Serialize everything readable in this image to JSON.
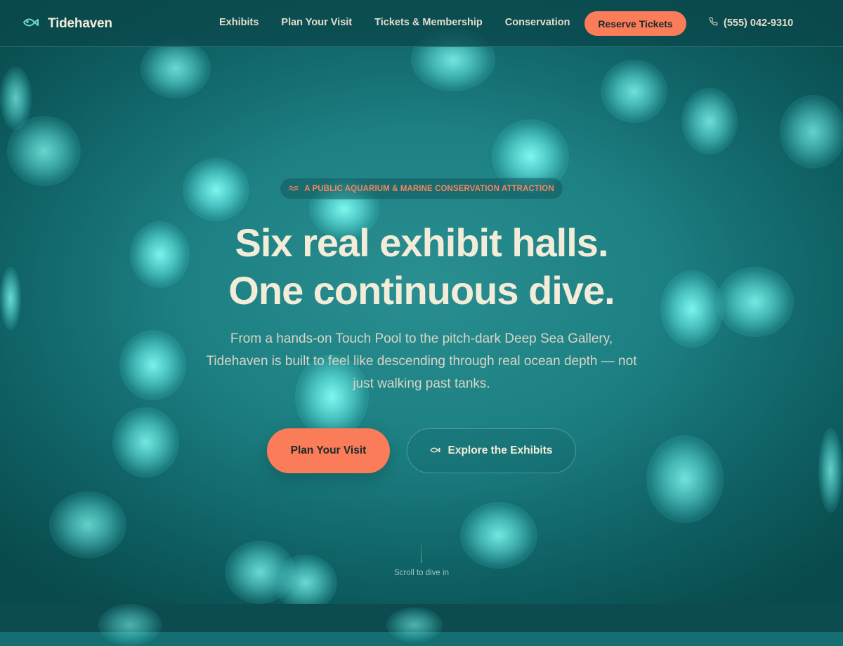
{
  "brand": {
    "name": "Tidehaven",
    "logo_icon": "fish-icon"
  },
  "nav": {
    "links": [
      {
        "label": "Exhibits"
      },
      {
        "label": "Plan Your Visit"
      },
      {
        "label": "Tickets & Membership"
      },
      {
        "label": "Conservation"
      }
    ],
    "cta_label": "Reserve Tickets",
    "phone": "(555) 042-9310",
    "phone_icon": "phone-icon"
  },
  "hero": {
    "eyebrow": "A PUBLIC AQUARIUM & MARINE CONSERVATION ATTRACTION",
    "eyebrow_icon": "waves-icon",
    "headline_line1": "Six real exhibit halls.",
    "headline_line2": "One continuous dive.",
    "lede": "From a hands-on Touch Pool to the pitch-dark Deep Sea Gallery, Tidehaven is built to feel like descending through real ocean depth — not just walking past tanks.",
    "primary_cta": "Plan Your Visit",
    "secondary_cta": "Explore the Exhibits",
    "secondary_cta_icon": "fish-icon",
    "scroll_hint": "Scroll to dive in"
  },
  "colors": {
    "accent": "#fa7c59",
    "cream": "#f3ecd9",
    "teal_dark": "#0c4c4f",
    "teal_mid": "#1d8083"
  }
}
